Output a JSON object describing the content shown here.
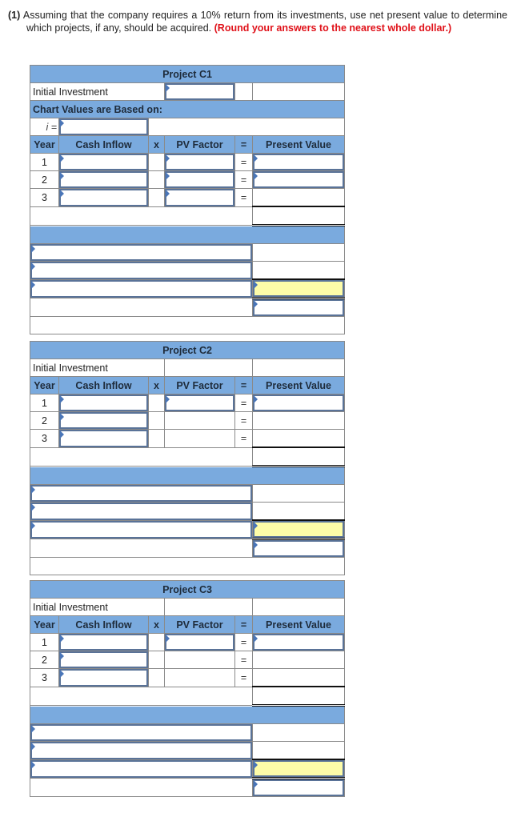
{
  "question": {
    "number": "(1)",
    "text": "Assuming that the company requires a 10% return from its investments, use net present value to determine which projects, if any, should be acquired.",
    "instruction": "(Round your answers to the nearest whole dollar.)"
  },
  "labels": {
    "initial_investment": "Initial Investment",
    "chart_values": "Chart Values are Based on:",
    "i_equals": "i =",
    "year": "Year",
    "cash_inflow": "Cash Inflow",
    "times": "x",
    "pv_factor": "PV Factor",
    "equals": "=",
    "present_value": "Present Value"
  },
  "projects": [
    {
      "title": "Project C1",
      "years": [
        "1",
        "2",
        "3"
      ]
    },
    {
      "title": "Project C2",
      "years": [
        "1",
        "2",
        "3"
      ]
    },
    {
      "title": "Project C3",
      "years": [
        "1",
        "2",
        "3"
      ]
    }
  ],
  "colors": {
    "header": "#7aaade",
    "highlight": "#fdfca8",
    "instruction": "#e0121a"
  }
}
